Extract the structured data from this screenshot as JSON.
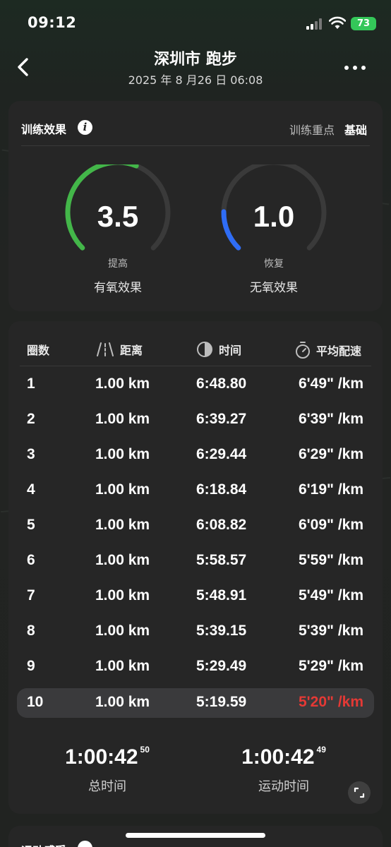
{
  "status_bar": {
    "time": "09:12",
    "battery": "73"
  },
  "header": {
    "title": "深圳市 跑步",
    "subtitle": "2025 年 8 月26 日 06:08"
  },
  "training": {
    "title": "训练效果",
    "focus_label": "训练重点",
    "focus_value": "基础",
    "aerobic": {
      "value": "3.5",
      "status": "提高",
      "label": "有氧效果",
      "fraction": 0.58,
      "color": "#43b649"
    },
    "anaerobic": {
      "value": "1.0",
      "status": "恢复",
      "label": "无氧效果",
      "fraction": 0.17,
      "color": "#2f6df6"
    }
  },
  "laps": {
    "headers": {
      "lap": "圈数",
      "distance": "距离",
      "time": "时间",
      "pace": "平均配速"
    },
    "rows": [
      {
        "lap": "1",
        "distance": "1.00 km",
        "time": "6:48.80",
        "pace": "6'49\" /km"
      },
      {
        "lap": "2",
        "distance": "1.00 km",
        "time": "6:39.27",
        "pace": "6'39\" /km"
      },
      {
        "lap": "3",
        "distance": "1.00 km",
        "time": "6:29.44",
        "pace": "6'29\" /km"
      },
      {
        "lap": "4",
        "distance": "1.00 km",
        "time": "6:18.84",
        "pace": "6'19\" /km"
      },
      {
        "lap": "5",
        "distance": "1.00 km",
        "time": "6:08.82",
        "pace": "6'09\" /km"
      },
      {
        "lap": "6",
        "distance": "1.00 km",
        "time": "5:58.57",
        "pace": "5'59\" /km"
      },
      {
        "lap": "7",
        "distance": "1.00 km",
        "time": "5:48.91",
        "pace": "5'49\" /km"
      },
      {
        "lap": "8",
        "distance": "1.00 km",
        "time": "5:39.15",
        "pace": "5'39\" /km"
      },
      {
        "lap": "9",
        "distance": "1.00 km",
        "time": "5:29.49",
        "pace": "5'29\" /km"
      },
      {
        "lap": "10",
        "distance": "1.00 km",
        "time": "5:19.59",
        "pace": "5'20\" /km"
      }
    ],
    "highlight_pace_color": "#e53935",
    "total_time": {
      "main": "1:00:42",
      "fraction": "50",
      "label": "总时间"
    },
    "moving_time": {
      "main": "1:00:42",
      "fraction": "49",
      "label": "运动时间"
    }
  },
  "next_section": {
    "title": "运动感受"
  }
}
